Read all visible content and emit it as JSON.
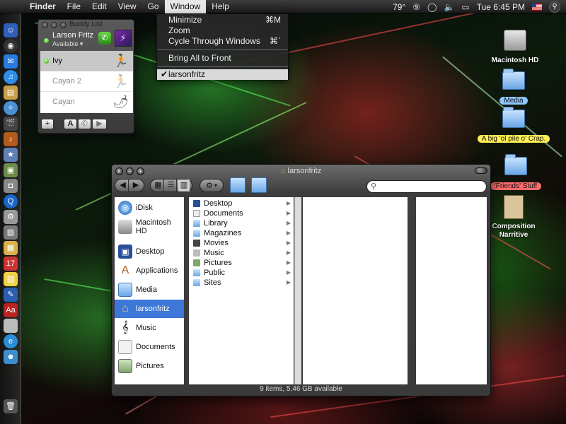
{
  "menubar": {
    "app": "Finder",
    "items": [
      "File",
      "Edit",
      "View",
      "Go",
      "Window",
      "Help"
    ],
    "active": "Window",
    "temperature": "79°",
    "clock": "Tue 6:45 PM"
  },
  "window_menu": {
    "minimize": "Minimize",
    "minimize_shortcut": "⌘M",
    "zoom": "Zoom",
    "cycle": "Cycle Through Windows",
    "cycle_shortcut": "⌘`",
    "bring_front": "Bring All to Front",
    "window_entry": "larsonfritz",
    "window_entry_checked": true
  },
  "buddy_list": {
    "title": "Buddy List",
    "my_name": "Larson Fritz",
    "my_status": "Available",
    "buddies": [
      {
        "name": "Ivy",
        "selected": true
      },
      {
        "name": "Cayan 2",
        "selected": false
      },
      {
        "name": "Cayan",
        "selected": false
      }
    ],
    "font_button": "A"
  },
  "desktop_icons": [
    {
      "label": "Macintosh HD"
    },
    {
      "label": "Media",
      "tag_color": "#8ec6ff"
    },
    {
      "label": "A big 'ol pile o' Crap.",
      "tag_color": "#ffee55"
    },
    {
      "label": "'Friends' Stuff",
      "tag_color": "#ff6b6b"
    },
    {
      "label": "Composition Narritive"
    }
  ],
  "finder": {
    "title": "larsonfritz",
    "sidebar": [
      {
        "label": "iDisk",
        "icon": "globe-icon"
      },
      {
        "label": "Macintosh HD",
        "icon": "disk-icon"
      },
      {
        "label": "Desktop",
        "icon": "desktop-icon"
      },
      {
        "label": "Applications",
        "icon": "applications-icon"
      },
      {
        "label": "Media",
        "icon": "folder-icon"
      },
      {
        "label": "larsonfritz",
        "icon": "home-icon",
        "selected": true
      },
      {
        "label": "Music",
        "icon": "music-icon"
      },
      {
        "label": "Documents",
        "icon": "documents-icon"
      },
      {
        "label": "Pictures",
        "icon": "pictures-icon"
      }
    ],
    "column1": [
      "Desktop",
      "Documents",
      "Library",
      "Magazines",
      "Movies",
      "Music",
      "Pictures",
      "Public",
      "Sites"
    ],
    "status": "9 items, 5.46 GB available",
    "accent": "#3d77d9"
  }
}
